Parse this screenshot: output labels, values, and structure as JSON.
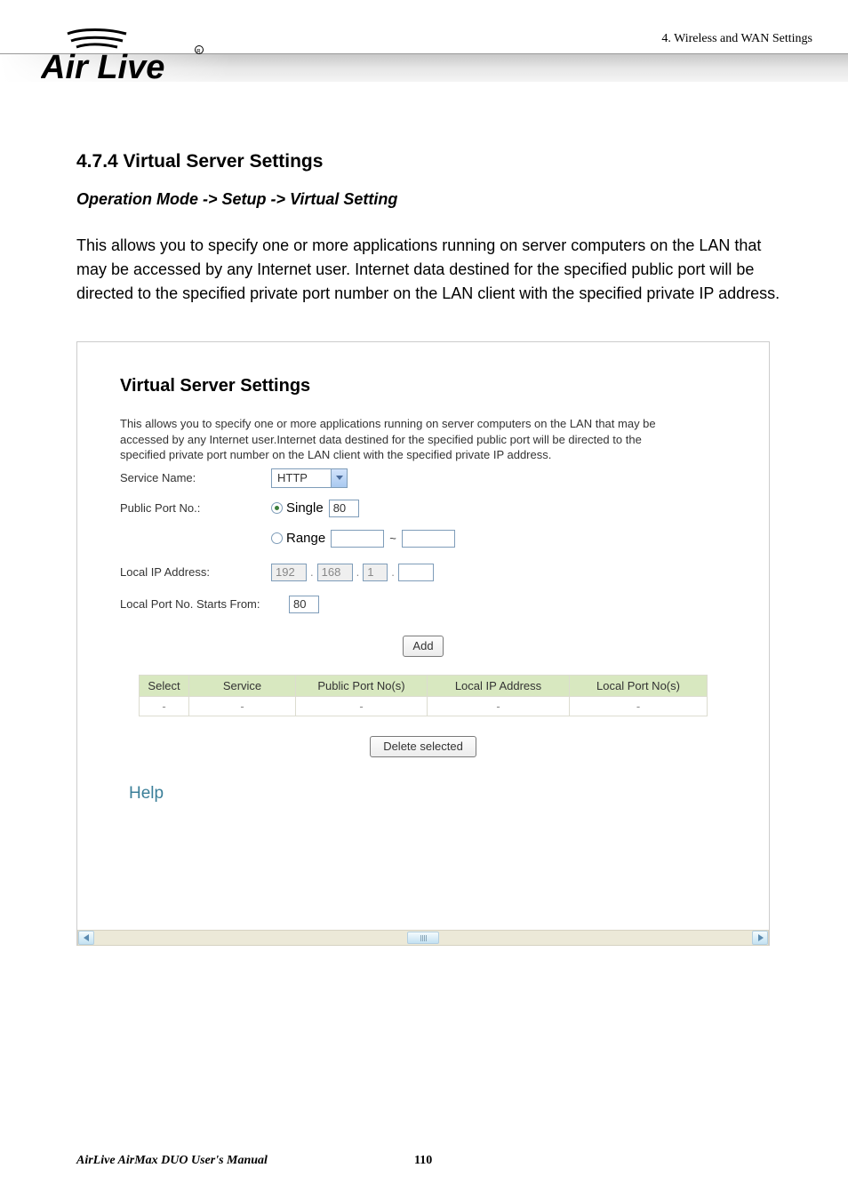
{
  "section_label": "4. Wireless and WAN Settings",
  "logo_text": "Air Live",
  "content": {
    "title": "4.7.4 Virtual Server Settings",
    "breadcrumb": "Operation Mode -> Setup -> Virtual Setting",
    "paragraph": "This allows you to specify one or more applications running on server computers on the LAN that may be accessed by any Internet user. Internet data destined for the specified public port will be directed to the specified private port number on the LAN client with the specified private IP address."
  },
  "settings": {
    "heading": "Virtual Server Settings",
    "description": "This allows you to specify one or more applications running on server computers on the LAN that may be accessed by any Internet user.Internet data destined for the specified public port will be directed to the specified private port number on the LAN client with the specified private IP address.",
    "service_name_label": "Service Name:",
    "service_name_value": "HTTP",
    "public_port": {
      "label": "Public Port No.:",
      "mode": "single",
      "single_label": "Single",
      "single_value": "80",
      "range_label": "Range",
      "range_from": "",
      "range_to": ""
    },
    "local_ip": {
      "label": "Local IP Address:",
      "octet1": "192",
      "octet2": "168",
      "octet3": "1",
      "octet4": ""
    },
    "local_port": {
      "label": "Local Port No. Starts From:",
      "value": "80"
    },
    "buttons": {
      "add": "Add",
      "delete": "Delete selected"
    },
    "table": {
      "cols": [
        "Select",
        "Service",
        "Public Port No(s)",
        "Local IP Address",
        "Local Port No(s)"
      ],
      "row": [
        "-",
        "-",
        "-",
        "-",
        "-"
      ]
    },
    "help": "Help"
  },
  "footer": {
    "title": "AirLive AirMax DUO User's Manual",
    "page": "110"
  }
}
